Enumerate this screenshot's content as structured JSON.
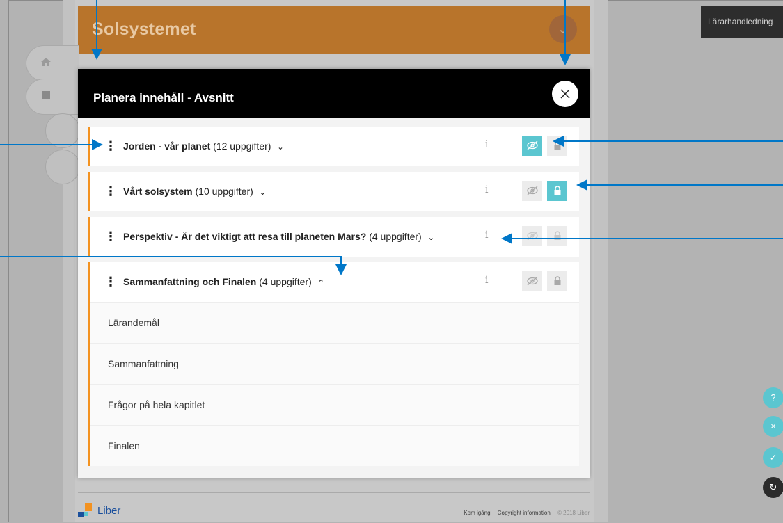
{
  "book": {
    "title": "Solsystemet"
  },
  "teacher_guide": {
    "label": "Lärarhandledning"
  },
  "modal": {
    "title": "Planera innehåll - Avsnitt",
    "sections": [
      {
        "title": "Jorden - vår planet",
        "count": "(12 uppgifter)",
        "hidden": true,
        "locked": false,
        "expanded": false
      },
      {
        "title": "Vårt solsystem",
        "count": "(10 uppgifter)",
        "hidden": false,
        "locked": true,
        "expanded": false
      },
      {
        "title": "Perspektiv - Är det viktigt att resa till planeten Mars?",
        "count": "(4 uppgifter)",
        "hidden": false,
        "locked": false,
        "expanded": false
      },
      {
        "title": "Sammanfattning och Finalen",
        "count": "(4 uppgifter)",
        "hidden": false,
        "locked": false,
        "expanded": true,
        "items": [
          "Lärandemål",
          "Sammanfattning",
          "Frågor på hela kapitlet",
          "Finalen"
        ]
      }
    ]
  },
  "footer": {
    "brand": "Liber",
    "links": [
      "Kom igång",
      "Copyright information"
    ],
    "copyright": "© 2018 Liber"
  },
  "fabs": [
    "?",
    "×",
    "✓",
    "↻"
  ],
  "colors": {
    "accent": "#5bc6d0",
    "section_border": "#f39220",
    "header": "#b8742b",
    "arrow": "#0077c8"
  }
}
